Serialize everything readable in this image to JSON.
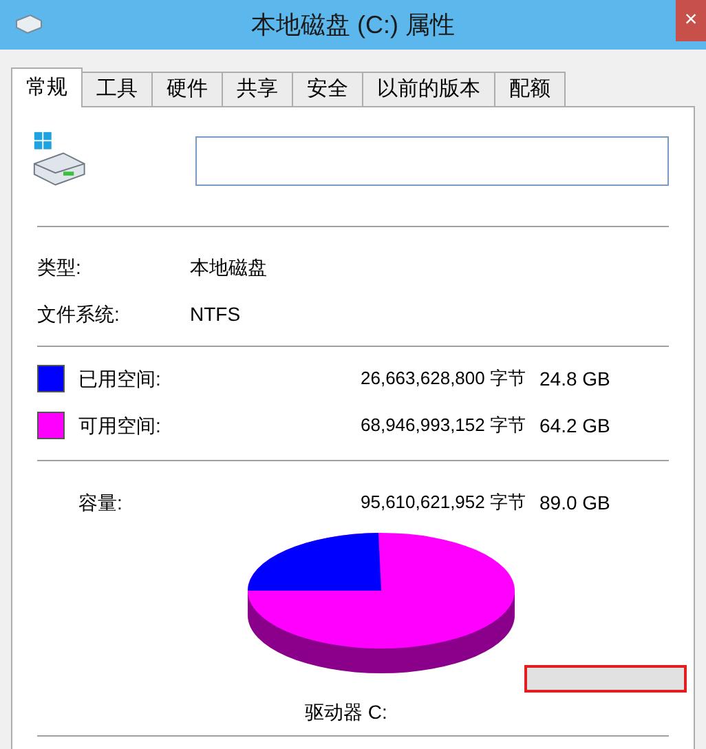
{
  "window": {
    "title": "本地磁盘 (C:) 属性",
    "close": "×"
  },
  "tabs": [
    {
      "label": "常规",
      "selected": true
    },
    {
      "label": "工具",
      "selected": false
    },
    {
      "label": "硬件",
      "selected": false
    },
    {
      "label": "共享",
      "selected": false
    },
    {
      "label": "安全",
      "selected": false
    },
    {
      "label": "以前的版本",
      "selected": false
    },
    {
      "label": "配额",
      "selected": false
    }
  ],
  "info": [
    {
      "label": "类型:",
      "value": "本地磁盘"
    },
    {
      "label": "文件系统:",
      "value": "NTFS"
    }
  ],
  "space": [
    {
      "label": "已用空间:",
      "bytes": "26,663,628,800 字节",
      "size": "24.8 GB",
      "color": "#0000ff"
    },
    {
      "label": "可用空间:",
      "bytes": "68,946,993,152 字节",
      "size": "64.2 GB",
      "color": "#ff00ff"
    }
  ],
  "capacity": {
    "label": "容量:",
    "bytes": "95,610,621,952 字节",
    "size": "89.0 GB"
  },
  "drive_label": "驱动器 C:"
}
